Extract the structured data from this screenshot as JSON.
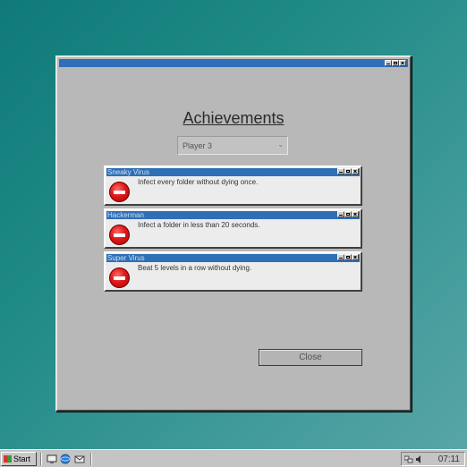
{
  "window": {
    "heading": "Achievements",
    "player_select": {
      "value": "Player 3"
    },
    "achievements": [
      {
        "title": "Sneaky Virus",
        "description": "Infect every folder without dying once.",
        "icon": "no-entry-icon"
      },
      {
        "title": "Hackerman",
        "description": "Infect a folder in less than 20 seconds.",
        "icon": "no-entry-icon"
      },
      {
        "title": "Super Virus",
        "description": "Beat 5 levels in a row without dying.",
        "icon": "no-entry-icon"
      }
    ],
    "close_label": "Close"
  },
  "taskbar": {
    "start_label": "Start",
    "clock": "07:11"
  },
  "colors": {
    "titlebar": "#2f6fb6",
    "window_bg": "#b8b8b8",
    "desktop": "#1f8a86"
  }
}
